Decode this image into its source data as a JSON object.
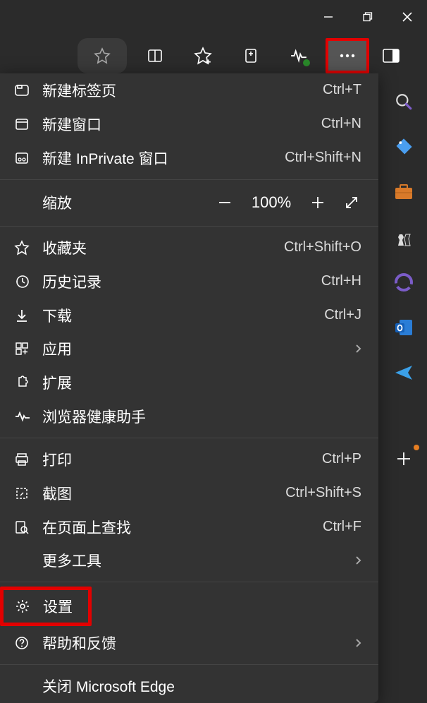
{
  "window": {
    "minimize": "—",
    "maximize": "❐",
    "close": "✕"
  },
  "toolbar": {
    "favorite": "star-icon",
    "split": "split-screen-icon",
    "favplus": "star-plus-icon",
    "collections": "collections-icon",
    "health": "health-icon",
    "more": "more-icon",
    "panel": "panel-icon"
  },
  "menu": {
    "new_tab": {
      "label": "新建标签页",
      "shortcut": "Ctrl+T"
    },
    "new_window": {
      "label": "新建窗口",
      "shortcut": "Ctrl+N"
    },
    "new_inprivate": {
      "label": "新建 InPrivate 窗口",
      "shortcut": "Ctrl+Shift+N"
    },
    "zoom": {
      "label": "缩放",
      "percent": "100%"
    },
    "favorites": {
      "label": "收藏夹",
      "shortcut": "Ctrl+Shift+O"
    },
    "history": {
      "label": "历史记录",
      "shortcut": "Ctrl+H"
    },
    "downloads": {
      "label": "下载",
      "shortcut": "Ctrl+J"
    },
    "apps": {
      "label": "应用"
    },
    "extensions": {
      "label": "扩展"
    },
    "browser_health": {
      "label": "浏览器健康助手"
    },
    "print": {
      "label": "打印",
      "shortcut": "Ctrl+P"
    },
    "screenshot": {
      "label": "截图",
      "shortcut": "Ctrl+Shift+S"
    },
    "find": {
      "label": "在页面上查找",
      "shortcut": "Ctrl+F"
    },
    "more_tools": {
      "label": "更多工具"
    },
    "settings": {
      "label": "设置"
    },
    "help": {
      "label": "帮助和反馈"
    },
    "close_edge": {
      "label": "关闭 Microsoft Edge"
    }
  },
  "sidebar": {
    "search": "search-icon",
    "tag": "tag-icon",
    "briefcase": "briefcase-icon",
    "chess": "chess-icon",
    "office": "office-icon",
    "outlook": "outlook-icon",
    "send": "send-icon",
    "add": "add-icon"
  }
}
